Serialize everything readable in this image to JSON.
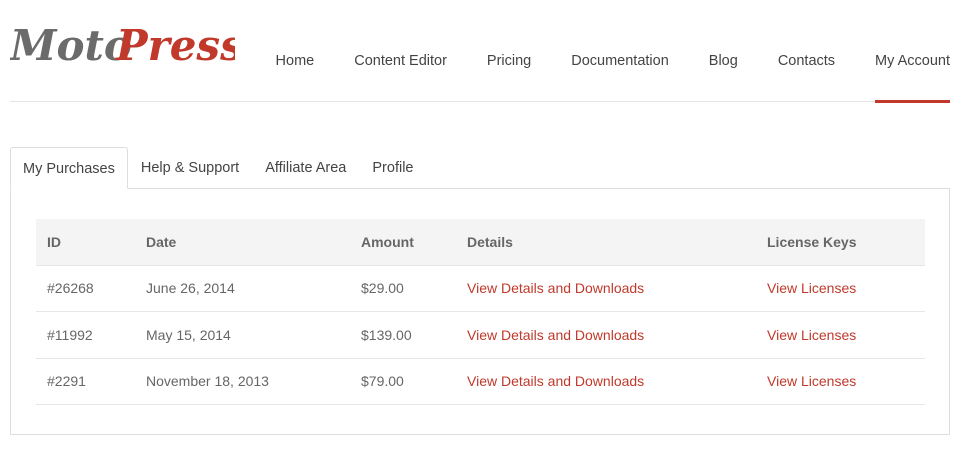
{
  "brand": {
    "logo_moto": "Moto",
    "logo_press": "Press",
    "accent_color": "#c0392b"
  },
  "nav": {
    "items": [
      "Home",
      "Content Editor",
      "Pricing",
      "Documentation",
      "Blog",
      "Contacts",
      "My Account"
    ],
    "active": "My Account"
  },
  "tabs": {
    "items": [
      "My Purchases",
      "Help & Support",
      "Affiliate Area",
      "Profile"
    ],
    "active": "My Purchases"
  },
  "purchases": {
    "headers": [
      "ID",
      "Date",
      "Amount",
      "Details",
      "License Keys"
    ],
    "rows": [
      {
        "id": "#26268",
        "date": "June 26, 2014",
        "amount": "$29.00",
        "details": "View Details and Downloads",
        "license": "View Licenses"
      },
      {
        "id": "#11992",
        "date": "May 15, 2014",
        "amount": "$139.00",
        "details": "View Details and Downloads",
        "license": "View Licenses"
      },
      {
        "id": "#2291",
        "date": "November 18, 2013",
        "amount": "$79.00",
        "details": "View Details and Downloads",
        "license": "View Licenses"
      }
    ]
  }
}
